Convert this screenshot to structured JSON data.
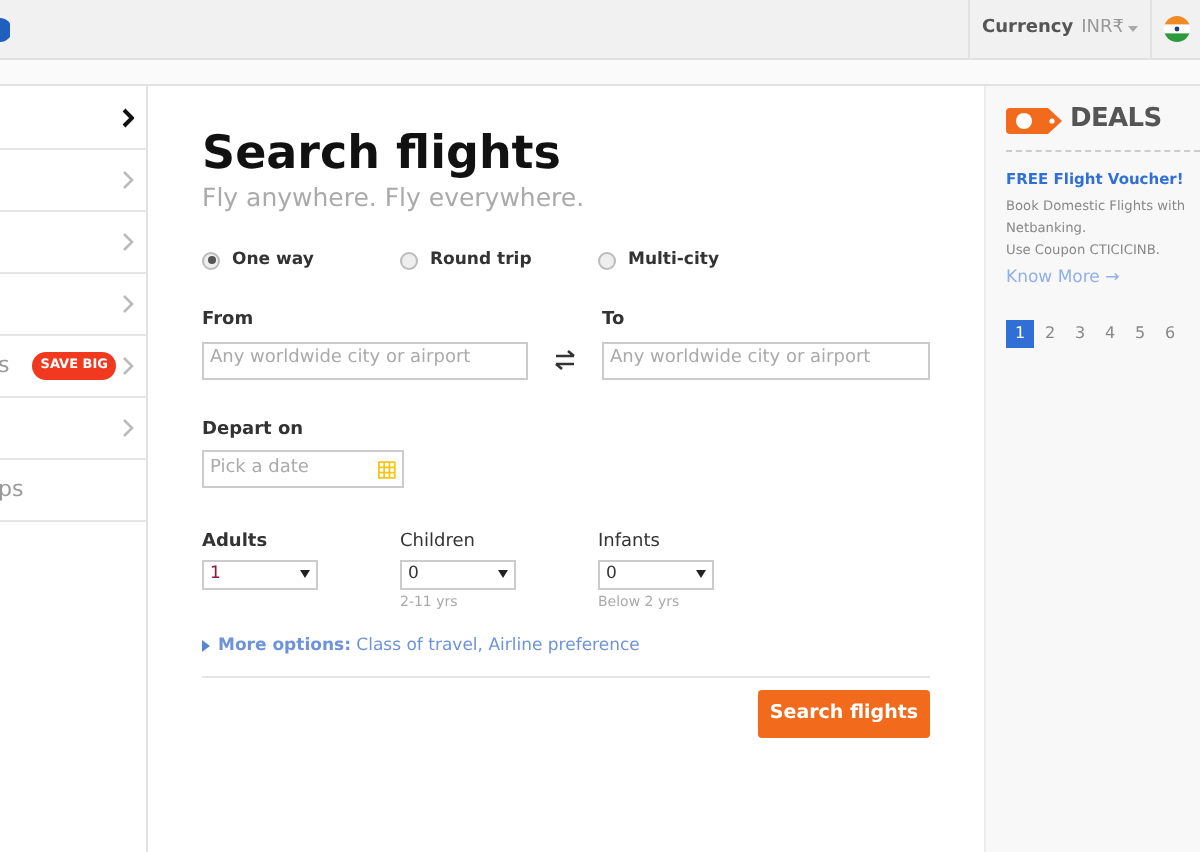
{
  "header": {
    "currency_label": "Currency",
    "currency_value": "INR₹"
  },
  "sidebar": {
    "items": [
      {
        "selected": true
      },
      {
        "selected": false
      },
      {
        "selected": false
      },
      {
        "selected": false
      },
      {
        "label": "s",
        "badge": "SAVE BIG",
        "selected": false
      },
      {
        "selected": false
      },
      {
        "label": "ps",
        "selected": false
      }
    ]
  },
  "form": {
    "title": "Search flights",
    "subtitle": "Fly anywhere. Fly everywhere.",
    "trip_types": [
      {
        "label": "One way",
        "selected": true
      },
      {
        "label": "Round trip",
        "selected": false
      },
      {
        "label": "Multi-city",
        "selected": false
      }
    ],
    "from": {
      "label": "From",
      "placeholder": "Any worldwide city or airport"
    },
    "to": {
      "label": "To",
      "placeholder": "Any worldwide city or airport"
    },
    "depart": {
      "label": "Depart on",
      "placeholder": "Pick a date"
    },
    "passengers": [
      {
        "label": "Adults",
        "value": "1"
      },
      {
        "label": "Children",
        "value": "0",
        "hint": "2-11 yrs"
      },
      {
        "label": "Infants",
        "value": "0",
        "hint": "Below 2 yrs"
      }
    ],
    "more_options": {
      "label": "More options:",
      "detail": "Class of travel, Airline preference"
    },
    "submit": "Search flights"
  },
  "deals": {
    "title": "DEALS",
    "offer_title": "FREE Flight Voucher!",
    "offer_lines": [
      "Book Domestic Flights with",
      "Netbanking.",
      "Use Coupon CTICICINB."
    ],
    "link": "Know More →",
    "pages": [
      {
        "label": "1",
        "selected": true
      },
      {
        "label": "2",
        "selected": false
      },
      {
        "label": "3",
        "selected": false
      },
      {
        "label": "4",
        "selected": false
      },
      {
        "label": "5",
        "selected": false
      },
      {
        "label": "6",
        "selected": false
      }
    ]
  }
}
